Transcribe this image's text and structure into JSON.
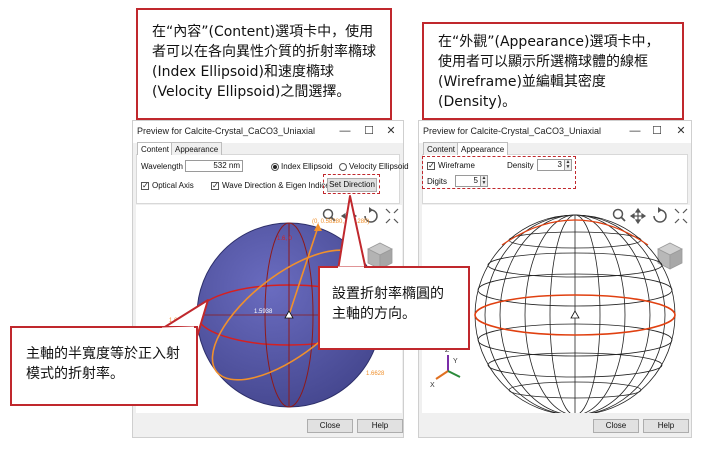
{
  "callouts": {
    "top_left": "在“內容”(Content)選項卡中，使用者可以在各向異性介質的折射率橢球(Index Ellipsoid)和速度橢球(Velocity Ellipsoid)之間選擇。",
    "top_right": "在“外觀”(Appearance)選項卡中，使用者可以顯示所選橢球體的線框(Wireframe)並編輯其密度(Density)。",
    "middle": "設置折射率橢圓的主軸的方向。",
    "bottom_left": "主軸的半寬度等於正入射模式的折射率。"
  },
  "left_window": {
    "title": "Preview for Calcite-Crystal_CaCO3_Uniaxial",
    "tabs": [
      "Content",
      "Appearance"
    ],
    "wavelength_label": "Wavelength",
    "wavelength_value": "532 nm",
    "index_ellipsoid_label": "Index Ellipsoid",
    "velocity_ellipsoid_label": "Velocity Ellipsoid",
    "optical_axis_label": "Optical Axis",
    "wave_direction_label": "Wave Direction & Eigen Indices",
    "set_direction_label": "Set Direction",
    "plot_labels": {
      "direction_readout": "(0, 0.58280, 0.81280)",
      "top_value": "1.6, 0",
      "center_value": "1.5938",
      "left_value": "1.6628",
      "bottom_right_value": "1.6628"
    },
    "close_label": "Close",
    "help_label": "Help"
  },
  "right_window": {
    "title": "Preview for Calcite-Crystal_CaCO3_Uniaxial",
    "tabs": [
      "Content",
      "Appearance"
    ],
    "wireframe_label": "Wireframe",
    "density_label": "Density",
    "density_value": "3",
    "digits_label": "Digits",
    "digits_value": "5",
    "close_label": "Close",
    "help_label": "Help"
  },
  "colors": {
    "callout_border": "#c0282d",
    "sphere": "#5456a6",
    "orange": "#f0902c",
    "red": "#d62020",
    "dark_red": "#8e1a1a"
  }
}
